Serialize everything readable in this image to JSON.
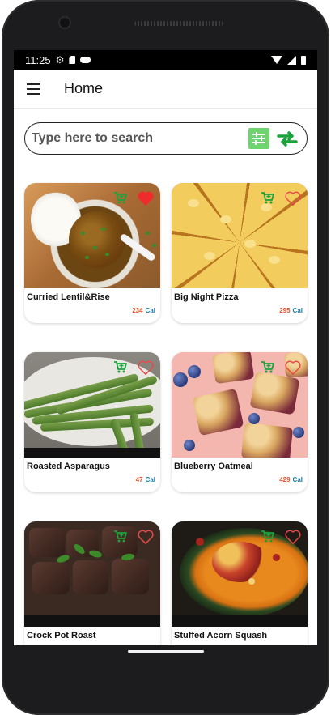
{
  "status_bar": {
    "time": "11:25"
  },
  "app_bar": {
    "title": "Home"
  },
  "search": {
    "placeholder": "Type here to search"
  },
  "recipes": [
    {
      "name": "Curried Lentil&Rise",
      "calories": "234",
      "unit": "Cal",
      "favorited": true
    },
    {
      "name": "Big Night Pizza",
      "calories": "295",
      "unit": "Cal",
      "favorited": false
    },
    {
      "name": "Roasted Asparagus",
      "calories": "47",
      "unit": "Cal",
      "favorited": false
    },
    {
      "name": "Blueberry Oatmeal",
      "calories": "429",
      "unit": "Cal",
      "favorited": false
    },
    {
      "name": "Crock Pot Roast",
      "calories": "",
      "unit": "",
      "favorited": false
    },
    {
      "name": "Stuffed Acorn Squash",
      "calories": "",
      "unit": "",
      "favorited": false
    }
  ],
  "colors": {
    "accent_green": "#1aa33a",
    "heart_red": "#ef2b2b",
    "heart_outline": "#e84a4a",
    "calorie_number": "#e2552f",
    "calorie_unit": "#1a7aa3"
  },
  "icons": {
    "menu": "menu-icon",
    "filter": "filter-icon",
    "refresh": "refresh-icon",
    "cart": "add-to-cart-icon",
    "favorite": "heart-icon"
  }
}
